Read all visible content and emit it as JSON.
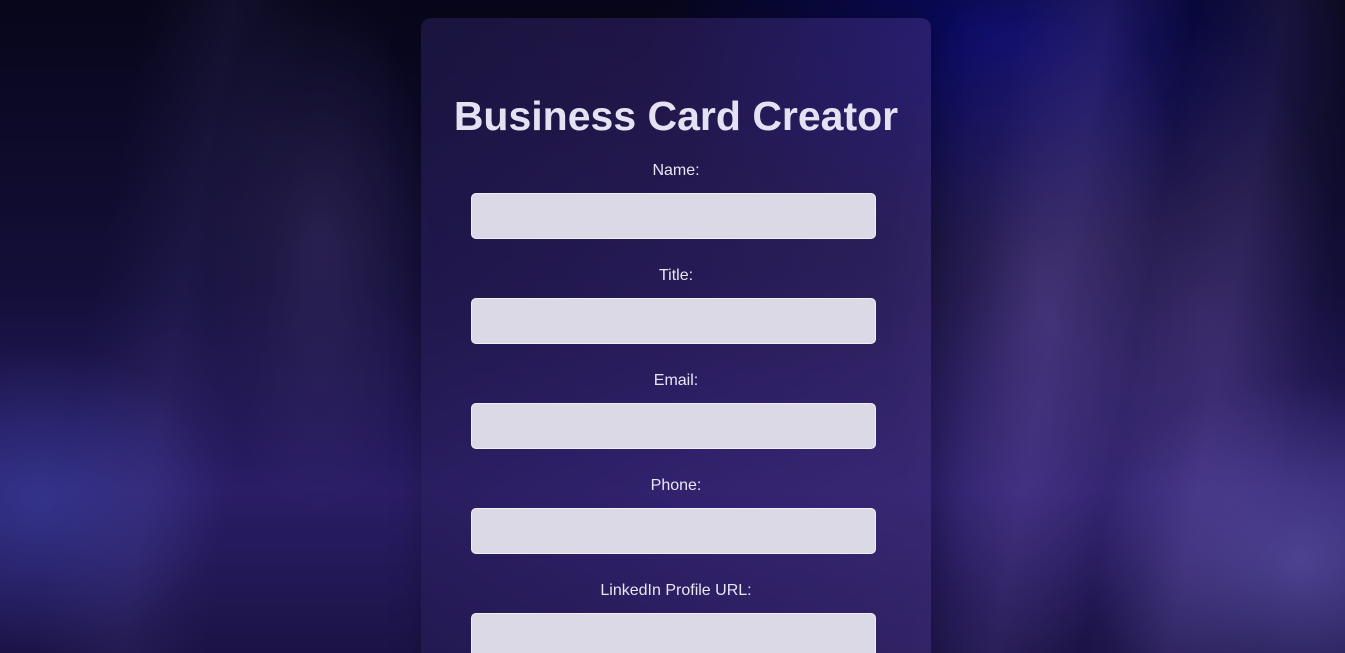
{
  "form": {
    "title": "Business Card Creator",
    "fields": [
      {
        "label": "Name:",
        "value": "",
        "placeholder": ""
      },
      {
        "label": "Title:",
        "value": "",
        "placeholder": ""
      },
      {
        "label": "Email:",
        "value": "",
        "placeholder": ""
      },
      {
        "label": "Phone:",
        "value": "",
        "placeholder": ""
      },
      {
        "label": "LinkedIn Profile URL:",
        "value": "",
        "placeholder": ""
      }
    ]
  },
  "colors": {
    "background": "#140f3a",
    "title_text": "#e4e1f2",
    "input_fill": "#dcd9e6"
  }
}
